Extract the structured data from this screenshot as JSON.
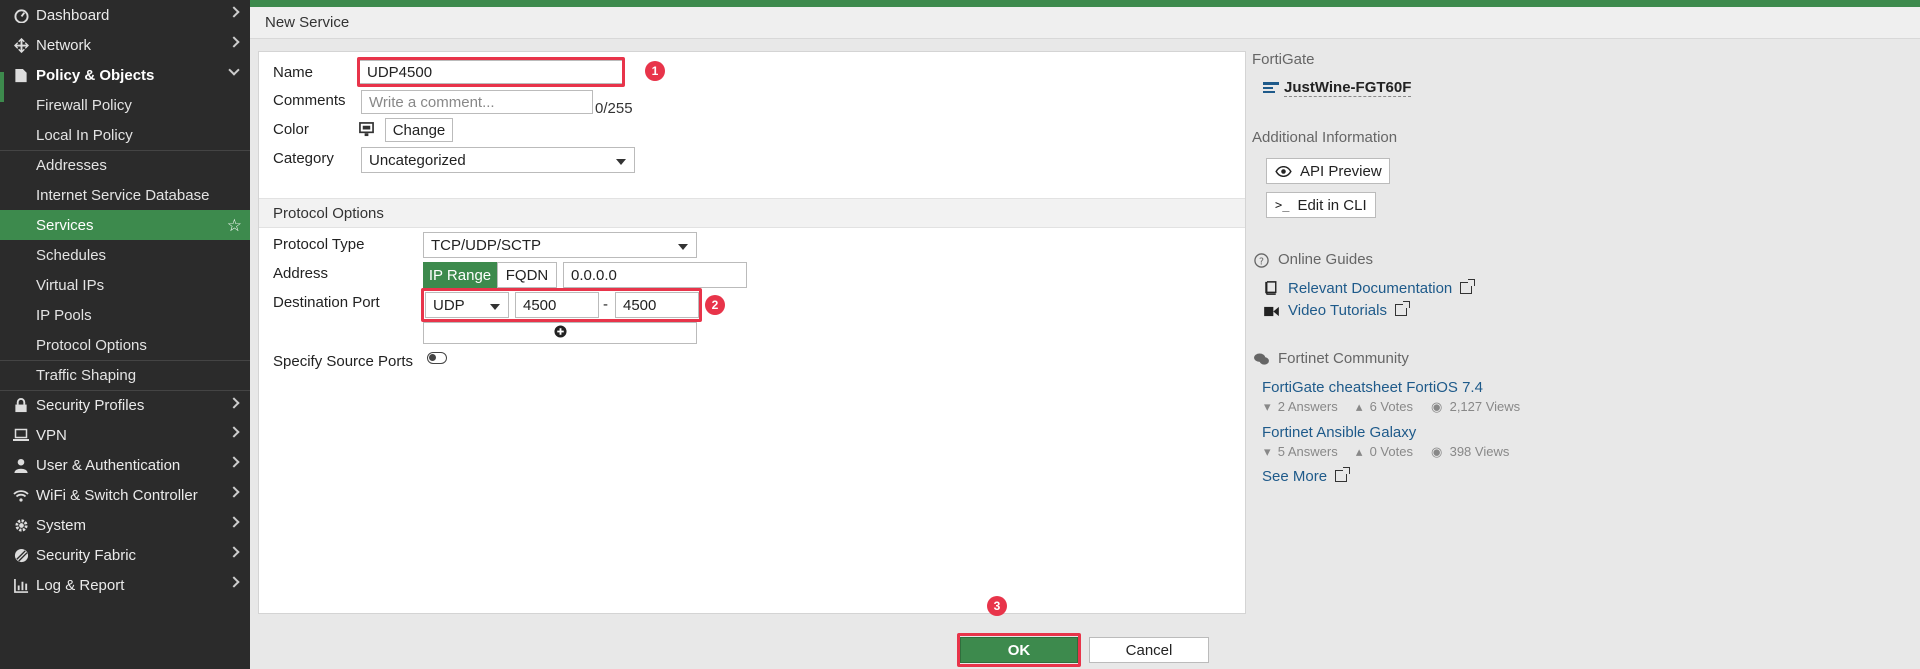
{
  "sidebar": {
    "items": [
      {
        "label": "Dashboard",
        "icon": "dashboard-icon"
      },
      {
        "label": "Network",
        "icon": "network-icon"
      },
      {
        "label": "Policy & Objects",
        "icon": "policy-icon"
      },
      {
        "label": "Security Profiles",
        "icon": "lock-icon"
      },
      {
        "label": "VPN",
        "icon": "laptop-icon"
      },
      {
        "label": "User & Authentication",
        "icon": "user-icon"
      },
      {
        "label": "WiFi & Switch Controller",
        "icon": "wifi-icon"
      },
      {
        "label": "System",
        "icon": "gear-icon"
      },
      {
        "label": "Security Fabric",
        "icon": "fabric-icon"
      },
      {
        "label": "Log & Report",
        "icon": "chart-icon"
      }
    ],
    "sub_items": [
      "Firewall Policy",
      "Local In Policy",
      "Addresses",
      "Internet Service Database",
      "Services",
      "Schedules",
      "Virtual IPs",
      "IP Pools",
      "Protocol Options",
      "Traffic Shaping"
    ]
  },
  "page": {
    "title": "New Service"
  },
  "form": {
    "name_label": "Name",
    "name_value": "UDP4500",
    "comments_label": "Comments",
    "comments_placeholder": "Write a comment...",
    "comments_count": "0/255",
    "color_label": "Color",
    "color_change": "Change",
    "category_label": "Category",
    "category_value": "Uncategorized",
    "section_title": "Protocol Options",
    "protocol_type_label": "Protocol Type",
    "protocol_type_value": "TCP/UDP/SCTP",
    "address_label": "Address",
    "address_iprange": "IP Range",
    "address_fqdn": "FQDN",
    "address_value": "0.0.0.0",
    "dest_port_label": "Destination Port",
    "dest_proto": "UDP",
    "port_low": "4500",
    "port_sep": "-",
    "port_high": "4500",
    "source_ports_label": "Specify Source Ports"
  },
  "badges": {
    "one": "1",
    "two": "2",
    "three": "3"
  },
  "info": {
    "fortigate_label": "FortiGate",
    "device_name": "JustWine-FGT60F",
    "additional_label": "Additional Information",
    "api_preview": "API Preview",
    "edit_cli": "Edit in CLI",
    "guides_label": "Online Guides",
    "relevant_docs": "Relevant Documentation",
    "video_tutorials": "Video Tutorials",
    "community_label": "Fortinet Community",
    "posts": [
      {
        "title": "FortiGate cheatsheet FortiOS 7.4",
        "answers": "2 Answers",
        "votes": "6 Votes",
        "views": "2,127 Views"
      },
      {
        "title": "Fortinet Ansible Galaxy",
        "answers": "5 Answers",
        "votes": "0 Votes",
        "views": "398 Views"
      }
    ],
    "see_more": "See More"
  },
  "footer": {
    "ok": "OK",
    "cancel": "Cancel"
  },
  "colors": {
    "accent": "#3d8a4d",
    "highlight": "#e8344a",
    "sidebar": "#2b2b2b"
  }
}
